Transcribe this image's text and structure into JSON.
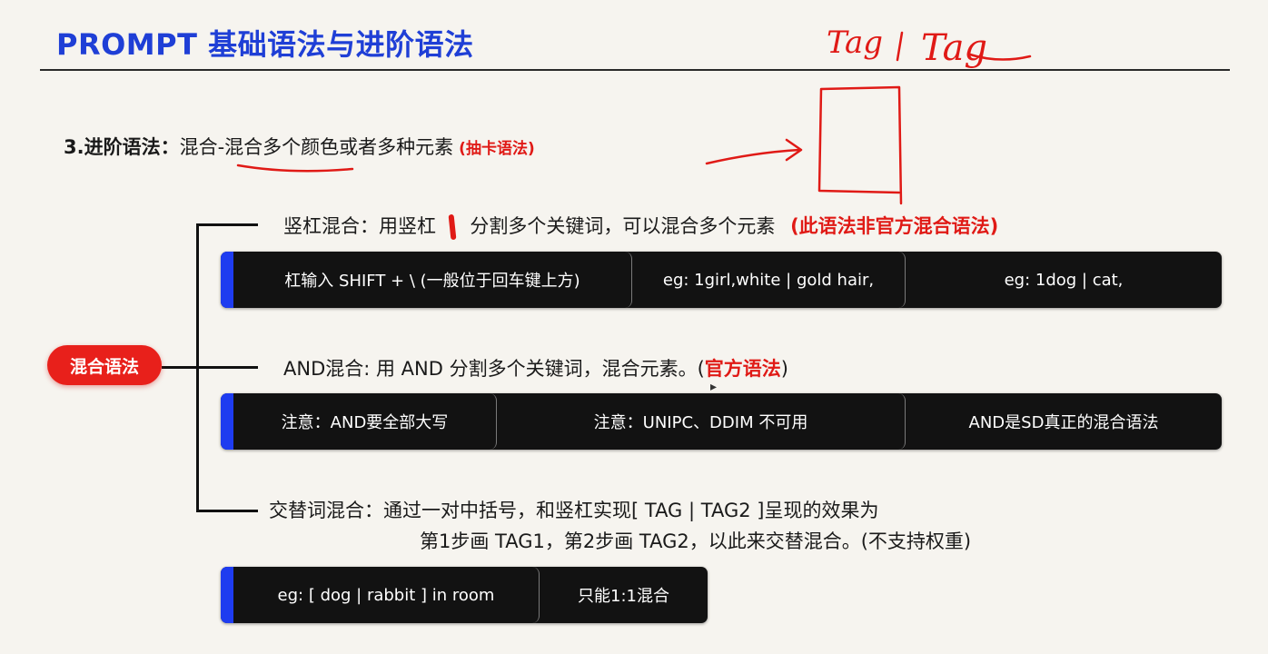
{
  "title": "PROMPT 基础语法与进阶语法",
  "section": {
    "num": "3.进阶语法",
    "colon": "：",
    "main": "混合-混合多个颜色或者多种元素",
    "note": "(抽卡语法)"
  },
  "handwriting": {
    "text1": "Tag",
    "text2": "Tag"
  },
  "root_pill": "混合语法",
  "items": [
    {
      "heading_prefix": "竖杠混合：用竖杠",
      "heading_suffix": "分割多个关键词，可以混合多个元素",
      "note": "(此语法非官方混合语法)",
      "cells": [
        "杠输入 SHIFT + \\ (一般位于回车键上方)",
        "eg: 1girl,white | gold hair,",
        "eg: 1dog | cat,"
      ]
    },
    {
      "heading_prefix": "AND混合: 用 AND 分割多个关键词，混合元素。(",
      "note": "官方语法",
      "heading_suffix": ")",
      "cells": [
        "注意：AND要全部大写",
        "注意：UNIPC、DDIM 不可用",
        "AND是SD真正的混合语法"
      ]
    },
    {
      "heading_line1": "交替词混合：通过一对中括号，和竖杠实现[ TAG | TAG2 ]呈现的效果为",
      "heading_line2": "第1步画 TAG1，第2步画 TAG2，以此来交替混合。(不支持权重)",
      "cells": [
        "eg: [ dog | rabbit ] in room",
        "只能1:1混合"
      ]
    }
  ],
  "colors": {
    "title_blue": "#1f3fd6",
    "accent_red": "#e01a16",
    "bar_bg": "#121212",
    "bar_accent": "#1e3cf0"
  }
}
